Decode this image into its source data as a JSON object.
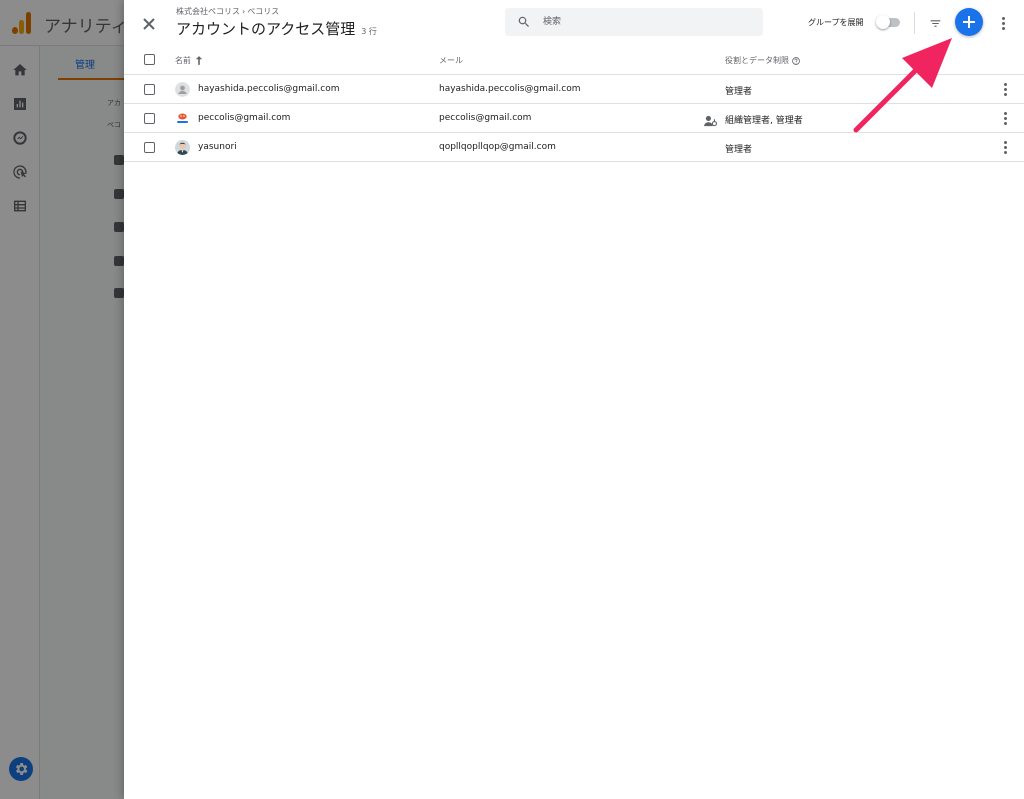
{
  "background": {
    "app_title": "アナリティ",
    "tab_label": "管理",
    "fragment_1": "アカ",
    "fragment_2": "ペコ"
  },
  "panel": {
    "breadcrumb": {
      "org": "株式会社ペコリス",
      "separator": "›",
      "account": "ペコリス"
    },
    "title": "アカウントのアクセス管理",
    "row_count": "3 行",
    "search": {
      "placeholder": "検索",
      "value": ""
    },
    "expand_group_label": "グループを展開",
    "expand_group_on": false,
    "table": {
      "headers": {
        "name": "名前",
        "email": "メール",
        "role": "役割とデータ制限"
      },
      "sort_direction": "ascending",
      "rows": [
        {
          "avatar": "default-person",
          "name": "hayashida.peccolis@gmail.com",
          "email": "hayashida.peccolis@gmail.com",
          "role": "管理者",
          "group": false
        },
        {
          "avatar": "peccolis-logo",
          "name": "peccolis@gmail.com",
          "email": "peccolis@gmail.com",
          "role": "組織管理者, 管理者",
          "group": true
        },
        {
          "avatar": "photo",
          "name": "yasunori",
          "email": "qopllqopllqop@gmail.com",
          "role": "管理者",
          "group": false
        }
      ]
    }
  },
  "colors": {
    "accent_blue": "#1a73e8",
    "annotation_arrow": "#f0245f",
    "analytics_orange": "#e37400",
    "analytics_yellow": "#f9ab00"
  },
  "icons": {
    "close": "close-icon",
    "search": "search-icon",
    "filter": "filter-icon",
    "add": "add-icon",
    "more": "more-vert-icon",
    "sort": "arrow-up-icon",
    "help": "help-icon",
    "group": "person-group-icon"
  }
}
